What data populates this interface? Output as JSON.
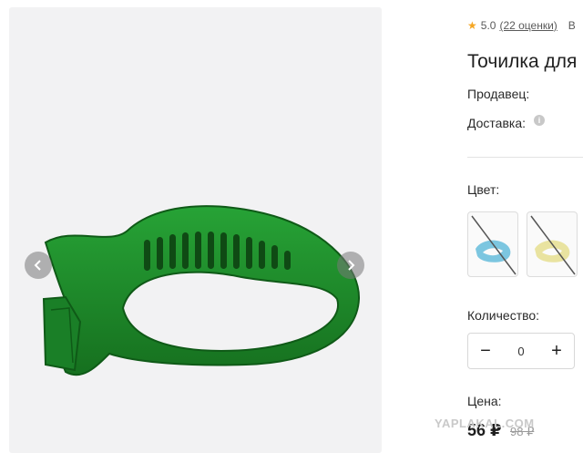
{
  "rating": {
    "value": "5.0",
    "reviews": "(22 оценки)",
    "extra": "В"
  },
  "product": {
    "title": "Точилка для"
  },
  "labels": {
    "seller": "Продавец:",
    "delivery": "Доставка:",
    "color": "Цвет:",
    "quantity": "Количество:",
    "price": "Цена:"
  },
  "quantity": {
    "value": "0",
    "minus": "−",
    "plus": "+"
  },
  "price": {
    "current": "56 ₽",
    "old": "98 ₽"
  },
  "watermark": "YAPLAKAL.COM",
  "colors": {
    "product": "#1e8c2a",
    "product_dark": "#146a1e",
    "swatch_blue": "#7cc6e0",
    "swatch_yellow": "#e9e3a0",
    "star": "#f5a623"
  },
  "icons": {
    "star": "star-icon",
    "info": "info-icon",
    "prev": "chevron-left-icon",
    "next": "chevron-right-icon"
  }
}
